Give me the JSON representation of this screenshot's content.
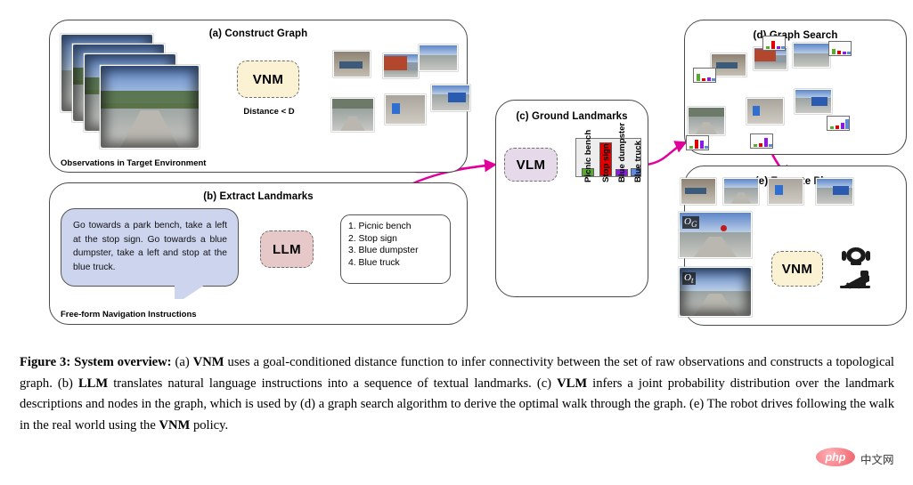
{
  "figure": {
    "panels": {
      "a": {
        "title": "(a)  Construct Graph",
        "block_label": "VNM",
        "distance_label": "Distance < D",
        "footer": "Observations in Target Environment"
      },
      "b": {
        "title": "(b) Extract Landmarks",
        "block_label": "LLM",
        "instruction": "Go towards a park bench, take a left at the stop sign. Go towards a blue dumpster, take a left and stop at the blue truck.",
        "footer": "Free-form Navigation Instructions",
        "landmarks": [
          "1. Picnic bench",
          "2. Stop sign",
          "3. Blue dumpster",
          "4. Blue truck"
        ]
      },
      "c": {
        "title": "(c) Ground Landmarks",
        "block_label": "VLM"
      },
      "d": {
        "title": "(d) Graph Search"
      },
      "e": {
        "title": "(e) Execute Plan",
        "block_label": "VNM",
        "goal_obs_label": "O",
        "goal_obs_sub": "G",
        "current_obs_label": "O",
        "current_obs_sub": "t"
      }
    },
    "caption": {
      "label": "Figure 3:",
      "lead": "System overview:",
      "text_1": " (a) ",
      "b1": "VNM",
      "text_2": " uses a goal-conditioned distance function to infer connectivity between the set of raw observations and constructs a topological graph.  (b) ",
      "b2": "LLM",
      "text_3": " translates natural language instructions into a sequence of textual landmarks.  (c) ",
      "b3": "VLM",
      "text_4": " infers a joint probability distribution over the landmark descriptions and nodes in the graph, which is used by (d) a graph search algorithm to derive the optimal walk through the graph. (e) The robot drives following the walk in the real world using the ",
      "b4": "VNM",
      "text_5": " policy."
    },
    "watermark": {
      "pill": "php",
      "text": "中文网"
    },
    "colors": {
      "vnm_block": "#fbf2d4",
      "llm_block": "#e7c8c8",
      "vlm_block": "#e6daea",
      "bubble": "#ccd4ee",
      "magenta_arrow": "#e2009b",
      "blue_arrow": "#3d7ff0",
      "graph_edge": "#9a9a9a"
    }
  },
  "chart_data": {
    "type": "bar",
    "title": "",
    "categories": [
      "Picnic bench",
      "Stop sign",
      "Blue dumpster",
      "Blue truck"
    ],
    "values": [
      0.22,
      0.95,
      0.2,
      0.22
    ],
    "colors": [
      "#5ba833",
      "#e00000",
      "#8c1ae0",
      "#5d8ae0"
    ],
    "xlabel": "",
    "ylabel": "",
    "ylim": [
      0,
      1
    ],
    "grid": false,
    "legend": "none"
  }
}
